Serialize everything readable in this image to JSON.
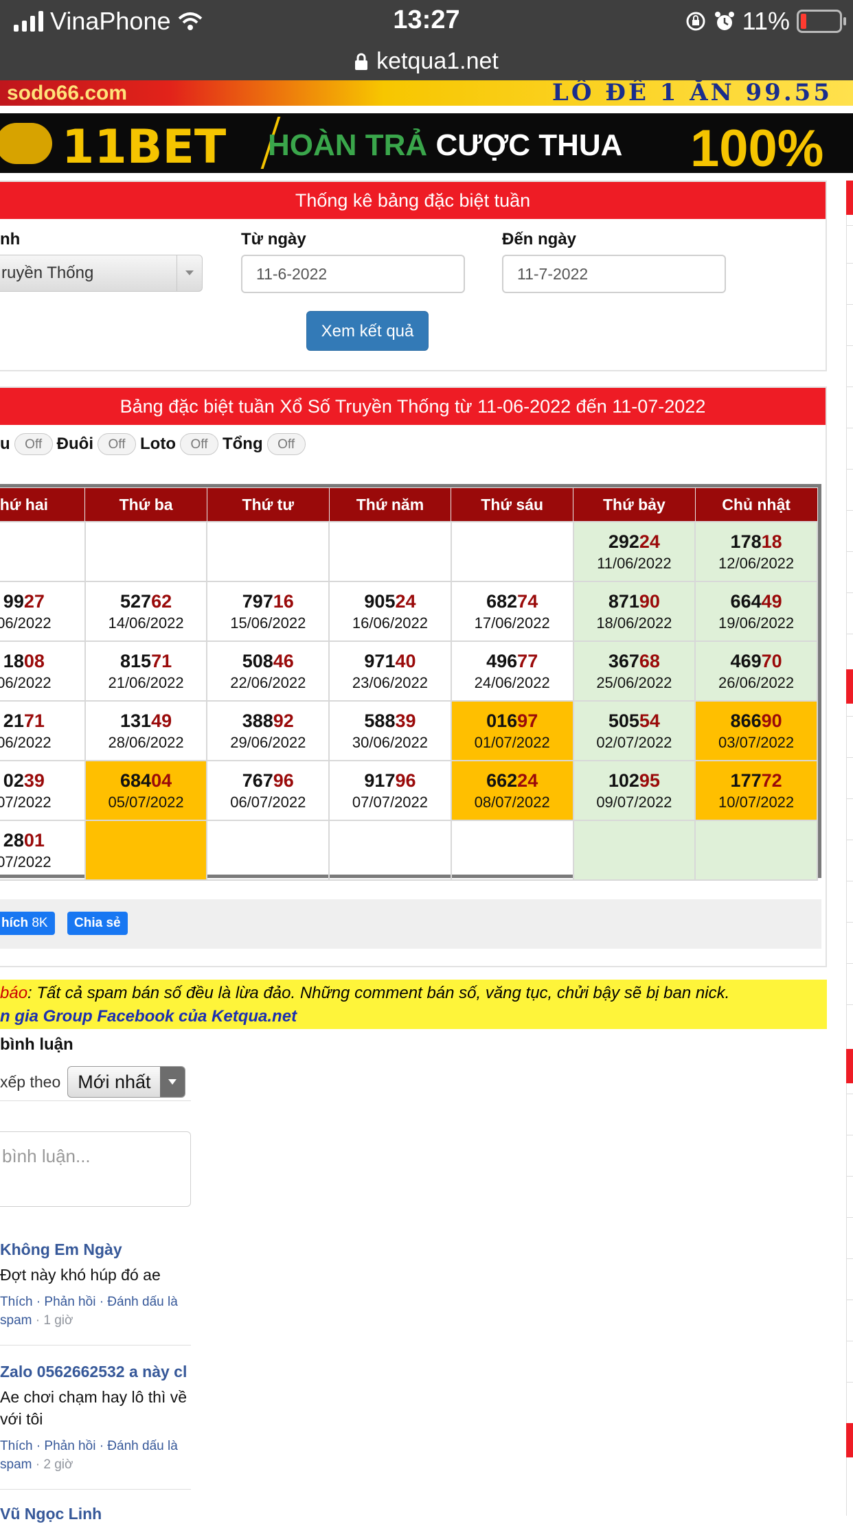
{
  "status": {
    "carrier": "VinaPhone",
    "time": "13:27",
    "battery": "11%"
  },
  "browser": {
    "url": "ketqua1.net"
  },
  "banners": {
    "top": {
      "left": "sodo66.com",
      "right": "LÔ ĐỀ 1 ĂN 99.55"
    },
    "second": {
      "brand": "11BET",
      "text_green": "HOÀN TRẢ",
      "text_white": "CƯỢC THUA",
      "percent": "100%"
    }
  },
  "filter": {
    "header": "Thống kê bảng đặc biệt tuần",
    "province_label": "nh",
    "province_value": "ruyền Thống",
    "from_label": "Từ ngày",
    "from_value": "11-6-2022",
    "to_label": "Đến ngày",
    "to_value": "11-7-2022",
    "submit": "Xem kết quả"
  },
  "table_panel": {
    "header": "Bảng đặc biệt tuần Xổ Số Truyền Thống từ 11-06-2022 đến 11-07-2022",
    "toggles": [
      {
        "label": "u",
        "state": "Off"
      },
      {
        "label": "Đuôi",
        "state": "Off"
      },
      {
        "label": "Loto",
        "state": "Off"
      },
      {
        "label": "Tổng",
        "state": "Off"
      }
    ],
    "columns": [
      "hứ hai",
      "Thứ ba",
      "Thứ tư",
      "Thứ năm",
      "Thứ sáu",
      "Thứ bảy",
      "Chủ nhật"
    ],
    "rows": [
      [
        {
          "head": "",
          "tail": "",
          "date": ""
        },
        {
          "head": "",
          "tail": "",
          "date": ""
        },
        {
          "head": "",
          "tail": "",
          "date": ""
        },
        {
          "head": "",
          "tail": "",
          "date": ""
        },
        {
          "head": "",
          "tail": "",
          "date": ""
        },
        {
          "head": "292",
          "tail": "24",
          "date": "11/06/2022"
        },
        {
          "head": "178",
          "tail": "18",
          "date": "12/06/2022"
        }
      ],
      [
        {
          "head": "99",
          "tail": "27",
          "date": "06/2022"
        },
        {
          "head": "527",
          "tail": "62",
          "date": "14/06/2022"
        },
        {
          "head": "797",
          "tail": "16",
          "date": "15/06/2022"
        },
        {
          "head": "905",
          "tail": "24",
          "date": "16/06/2022"
        },
        {
          "head": "682",
          "tail": "74",
          "date": "17/06/2022"
        },
        {
          "head": "871",
          "tail": "90",
          "date": "18/06/2022"
        },
        {
          "head": "664",
          "tail": "49",
          "date": "19/06/2022"
        }
      ],
      [
        {
          "head": "18",
          "tail": "08",
          "date": "06/2022"
        },
        {
          "head": "815",
          "tail": "71",
          "date": "21/06/2022"
        },
        {
          "head": "508",
          "tail": "46",
          "date": "22/06/2022"
        },
        {
          "head": "971",
          "tail": "40",
          "date": "23/06/2022"
        },
        {
          "head": "496",
          "tail": "77",
          "date": "24/06/2022"
        },
        {
          "head": "367",
          "tail": "68",
          "date": "25/06/2022"
        },
        {
          "head": "469",
          "tail": "70",
          "date": "26/06/2022"
        }
      ],
      [
        {
          "head": "21",
          "tail": "71",
          "date": "06/2022"
        },
        {
          "head": "131",
          "tail": "49",
          "date": "28/06/2022"
        },
        {
          "head": "388",
          "tail": "92",
          "date": "29/06/2022"
        },
        {
          "head": "588",
          "tail": "39",
          "date": "30/06/2022"
        },
        {
          "head": "016",
          "tail": "97",
          "date": "01/07/2022"
        },
        {
          "head": "505",
          "tail": "54",
          "date": "02/07/2022"
        },
        {
          "head": "866",
          "tail": "90",
          "date": "03/07/2022"
        }
      ],
      [
        {
          "head": "02",
          "tail": "39",
          "date": "07/2022"
        },
        {
          "head": "684",
          "tail": "04",
          "date": "05/07/2022"
        },
        {
          "head": "767",
          "tail": "96",
          "date": "06/07/2022"
        },
        {
          "head": "917",
          "tail": "96",
          "date": "07/07/2022"
        },
        {
          "head": "662",
          "tail": "24",
          "date": "08/07/2022"
        },
        {
          "head": "102",
          "tail": "95",
          "date": "09/07/2022"
        },
        {
          "head": "177",
          "tail": "72",
          "date": "10/07/2022"
        }
      ],
      [
        {
          "head": "28",
          "tail": "01",
          "date": "07/2022"
        },
        {
          "head": "",
          "tail": "",
          "date": ""
        },
        {
          "head": "",
          "tail": "",
          "date": ""
        },
        {
          "head": "",
          "tail": "",
          "date": ""
        },
        {
          "head": "",
          "tail": "",
          "date": ""
        },
        {
          "head": "",
          "tail": "",
          "date": ""
        },
        {
          "head": "",
          "tail": "",
          "date": ""
        }
      ]
    ],
    "highlight_color": "#ffbf00",
    "weekend_color": "#dff0d8",
    "tail_color": "#9a0a0a"
  },
  "share": {
    "like": "hích",
    "like_count": "8K",
    "share": "Chia sẻ"
  },
  "notice": {
    "prefix": "báo",
    "text": ": Tất cả spam bán số đều là lừa đảo. Những comment bán số, văng tục, chửi bậy sẽ bị ban nick.",
    "group": "n gia Group Facebook của Ketqua.net"
  },
  "comments": {
    "title": "bình luận",
    "sort_label": "xếp theo",
    "sort_value": "Mới nhất",
    "placeholder": "bình luận...",
    "items": [
      {
        "name": "Không Em Ngày",
        "text": "Đợt này khó húp đó ae",
        "actions": "Thích · Phản hồi · Đánh dấu là",
        "actions2": "spam",
        "time": " · 1 giờ"
      },
      {
        "name": "Zalo 0562662532 a này cl",
        "text": "Ae chơi chạm hay lô thì về với tôi",
        "actions": "Thích · Phản hồi · Đánh dấu là",
        "actions2": "spam",
        "time": " · 2 giờ"
      },
      {
        "name": "Vũ Ngọc Linh",
        "text": "",
        "actions": "",
        "actions2": "",
        "time": ""
      }
    ]
  }
}
